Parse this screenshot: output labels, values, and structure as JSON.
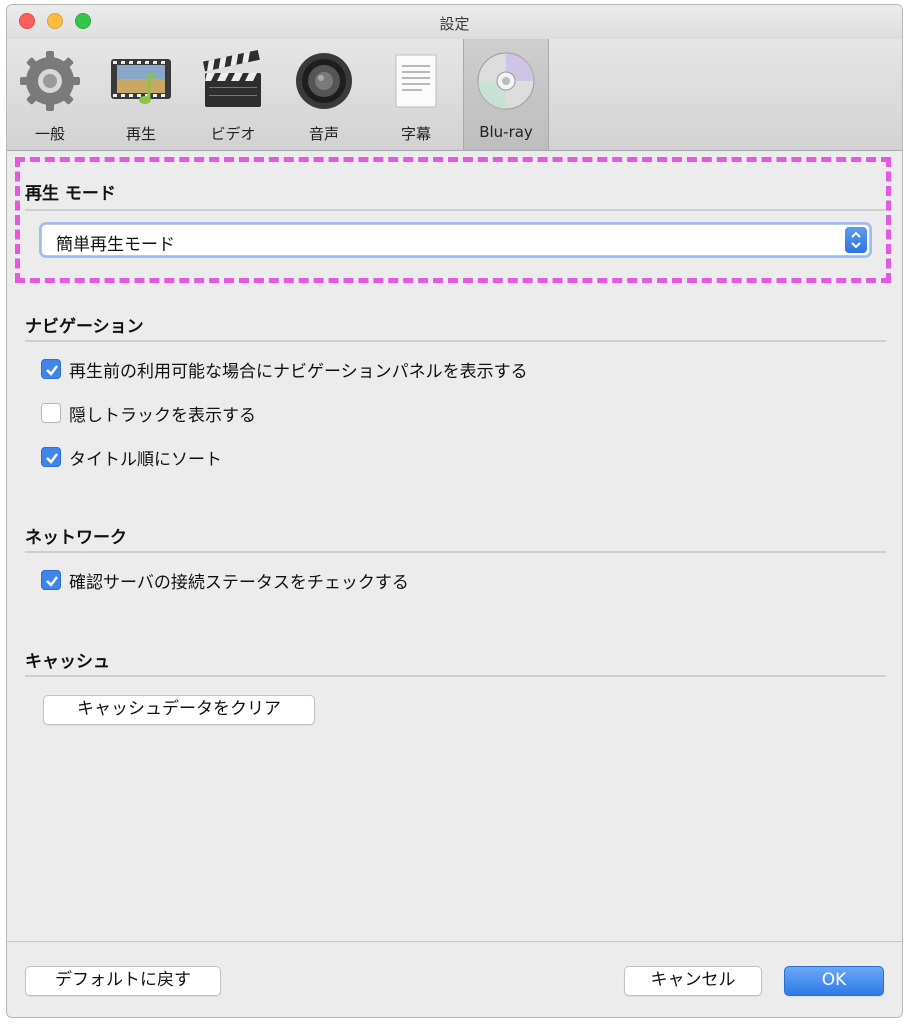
{
  "window": {
    "title": "設定"
  },
  "tabs": [
    {
      "label": "一般",
      "icon": "gear-icon"
    },
    {
      "label": "再生",
      "icon": "film-music-icon"
    },
    {
      "label": "ビデオ",
      "icon": "clapperboard-icon"
    },
    {
      "label": "音声",
      "icon": "speaker-icon"
    },
    {
      "label": "字幕",
      "icon": "document-icon"
    },
    {
      "label": "Blu-ray",
      "icon": "disc-icon",
      "selected": true
    }
  ],
  "playback_mode": {
    "title": "再生 モード",
    "selected": "簡単再生モード"
  },
  "navigation": {
    "title": "ナビゲーション",
    "options": [
      {
        "label": "再生前の利用可能な場合にナビゲーションパネルを表示する",
        "checked": true
      },
      {
        "label": "隠しトラックを表示する",
        "checked": false
      },
      {
        "label": "タイトル順にソート",
        "checked": true
      }
    ]
  },
  "network": {
    "title": "ネットワーク",
    "options": [
      {
        "label": "確認サーバの接続ステータスをチェックする",
        "checked": true
      }
    ]
  },
  "cache": {
    "title": "キャッシュ",
    "clear_button": "キャッシュデータをクリア"
  },
  "footer": {
    "default_button": "デフォルトに戻す",
    "cancel_button": "キャンセル",
    "ok_button": "OK"
  },
  "colors": {
    "accent": "#3f86ea",
    "highlight_dashes": "#e35ae0"
  }
}
